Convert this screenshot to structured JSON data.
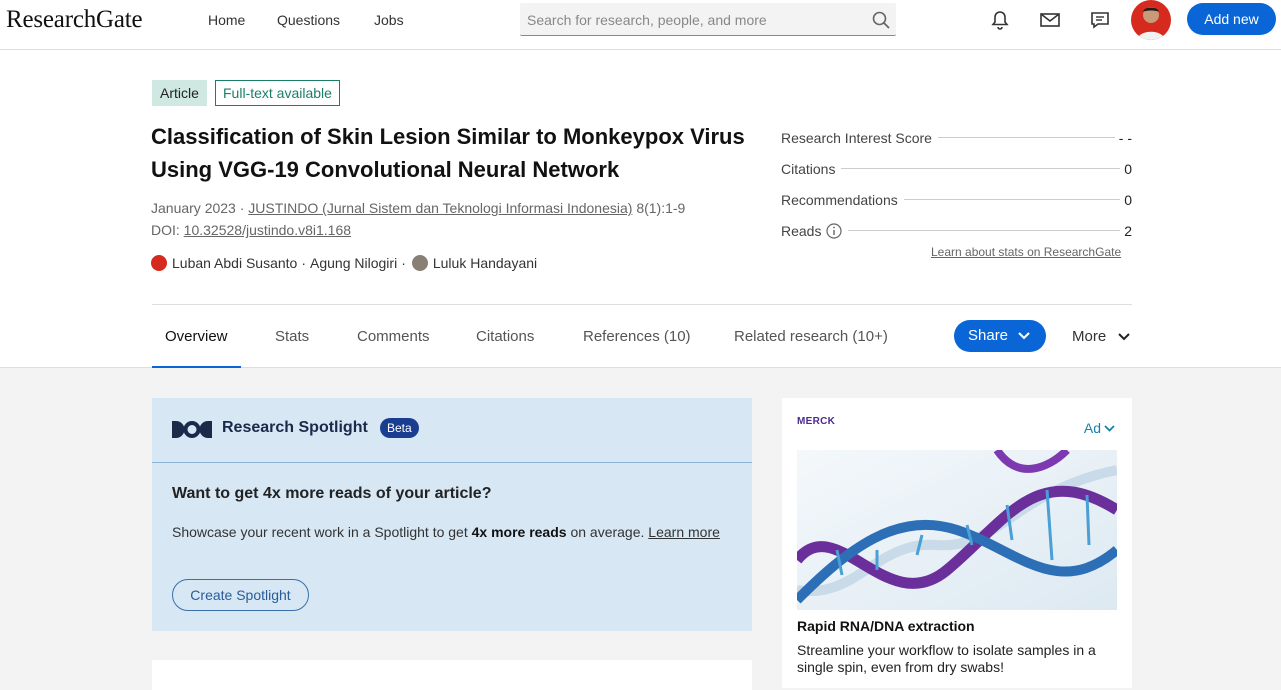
{
  "nav": {
    "logo": "ResearchGate",
    "links": [
      "Home",
      "Questions",
      "Jobs"
    ],
    "search_placeholder": "Search for research, people, and more",
    "add_new": "Add new"
  },
  "article": {
    "badge_type": "Article",
    "badge_fulltext": "Full-text available",
    "title": "Classification of Skin Lesion Similar to Monkeypox Virus Using VGG-19 Convolutional Neural Network",
    "date": "January 2023",
    "journal": "JUSTINDO (Jurnal Sistem dan Teknologi Informasi Indonesia)",
    "volume": "8(1):1-9",
    "doi_label": "DOI:",
    "doi": "10.32528/justindo.v8i1.168",
    "authors": [
      "Luban Abdi Susanto",
      "Agung Nilogiri",
      "Luluk Handayani"
    ]
  },
  "stats": {
    "rows": [
      {
        "label": "Research Interest Score",
        "value": "- -"
      },
      {
        "label": "Citations",
        "value": "0"
      },
      {
        "label": "Recommendations",
        "value": "0"
      },
      {
        "label": "Reads",
        "value": "2"
      }
    ],
    "learn_link": "Learn about stats on ResearchGate"
  },
  "tabs": {
    "items": [
      "Overview",
      "Stats",
      "Comments",
      "Citations",
      "References (10)",
      "Related research (10+)"
    ],
    "share": "Share",
    "more": "More"
  },
  "spotlight": {
    "title": "Research Spotlight",
    "beta": "Beta",
    "question": "Want to get 4x more reads of your article?",
    "desc_before": "Showcase your recent work in a Spotlight to get ",
    "desc_bold": "4x more reads",
    "desc_after": " on average. ",
    "learn_more": "Learn more",
    "button": "Create Spotlight"
  },
  "ad": {
    "brand": "MERCK",
    "label": "Ad",
    "headline": "Rapid RNA/DNA extraction",
    "body": "Streamline your workflow to isolate samples in a single spin, even from dry swabs!"
  },
  "colors": {
    "primary": "#0a66d6",
    "spotlight_bg": "#d7e7f4",
    "article_badge_bg": "#cfe9e2",
    "fulltext_green": "#1a7f6a"
  }
}
